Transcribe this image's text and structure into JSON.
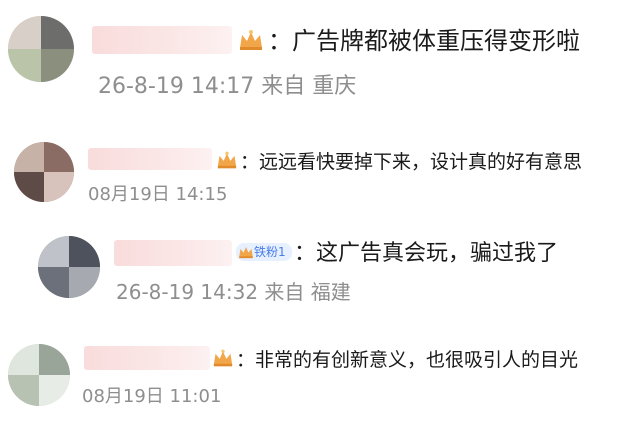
{
  "comments": [
    {
      "text": "：广告牌都被体重压得变形啦",
      "meta": "26-8-19 14:17 来自 重庆"
    },
    {
      "text": "：远远看快要掉下来，设计真的好有意思",
      "meta": "08月19日 14:15"
    },
    {
      "fan_badge": "铁粉1",
      "text": "：这广告真会玩，骗过我了",
      "meta": "26-8-19 14:32 来自 福建"
    },
    {
      "text": "：非常的有创新意义，也很吸引人的目光",
      "meta": "08月19日 11:01"
    }
  ],
  "colors": {
    "text": "#1a1a1a",
    "meta": "#8e8e8e",
    "fan_badge_bg": "#e6f0ff",
    "fan_badge_text": "#4a7de8",
    "crown": "#f2a64a"
  }
}
